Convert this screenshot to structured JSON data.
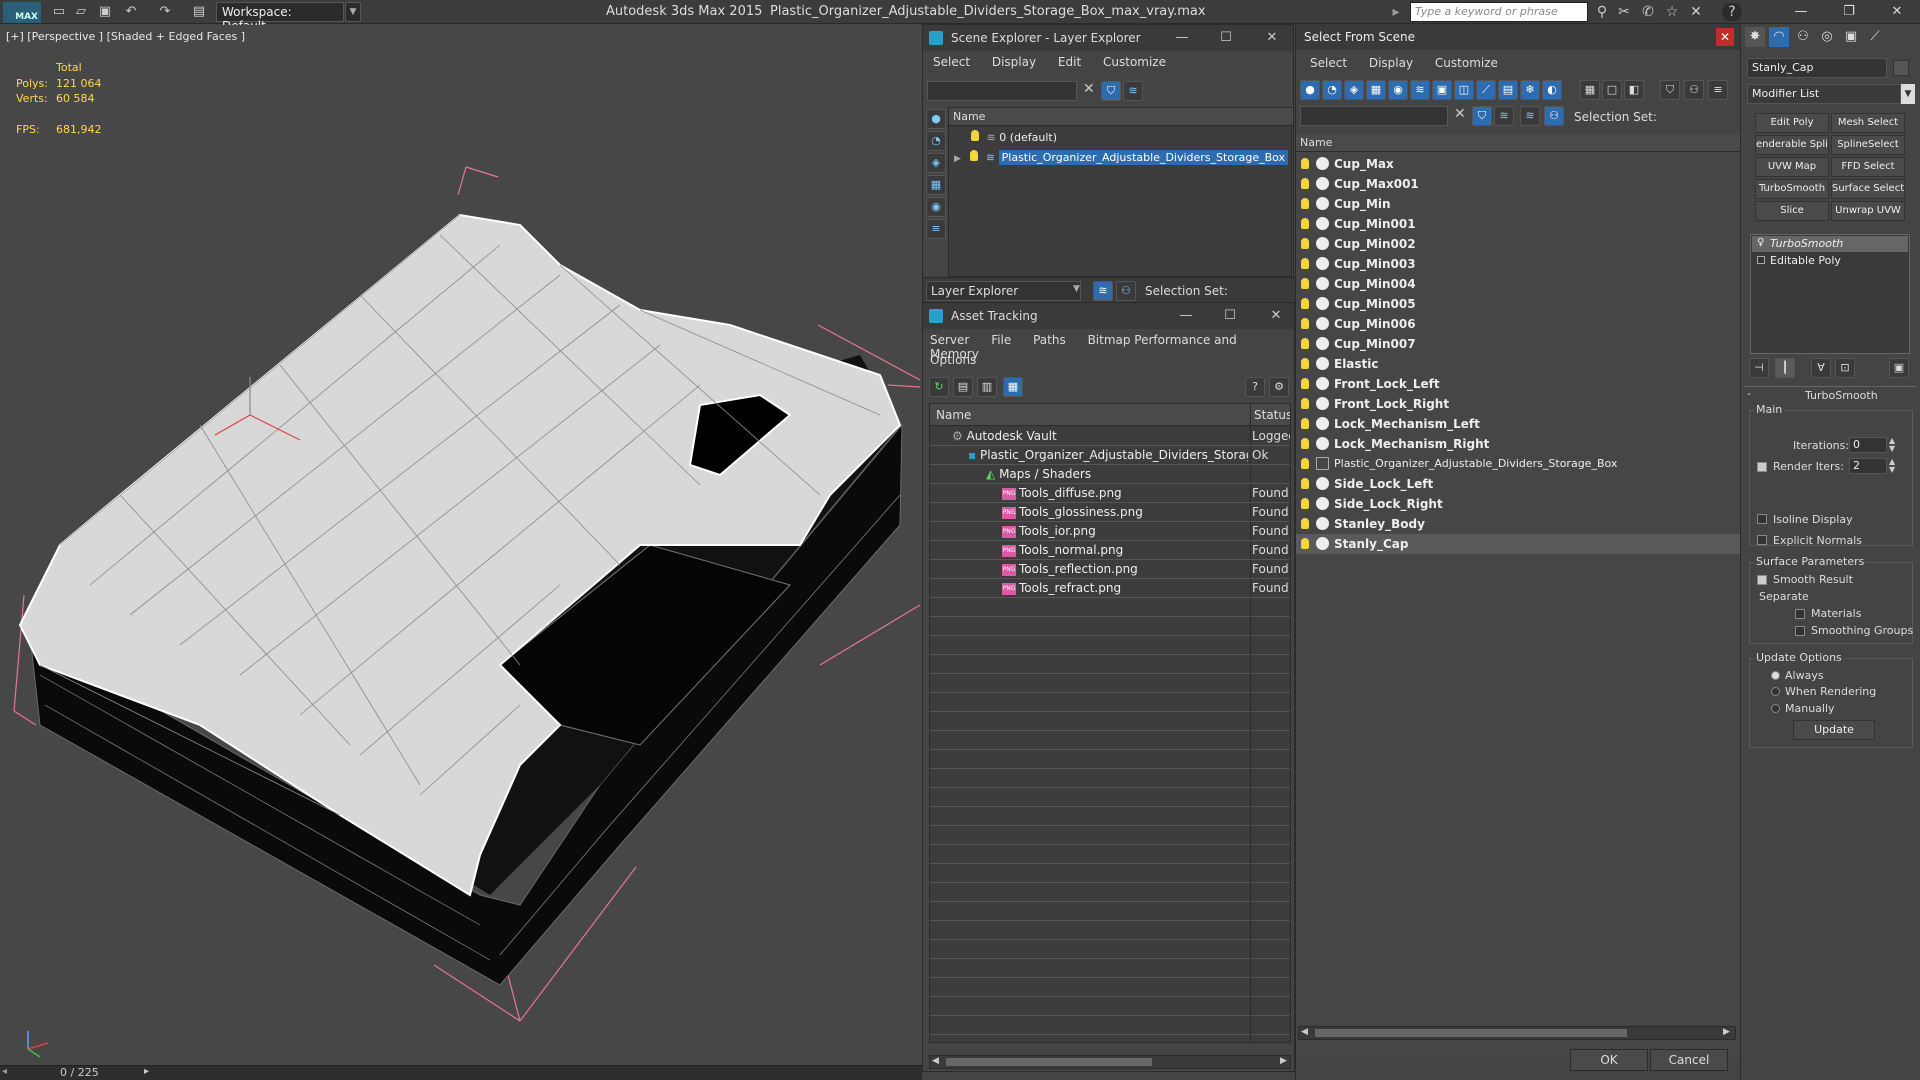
{
  "titlebar": {
    "logo": "MAX",
    "workspace": "Workspace: Default",
    "app_title": "Autodesk 3ds Max  2015",
    "doc_title": "Plastic_Organizer_Adjustable_Dividers_Storage_Box_max_vray.max",
    "search_placeholder": "Type a keyword or phrase"
  },
  "viewport": {
    "label": "[+] [Perspective ] [Shaded + Edged Faces ]",
    "stats_total": "Total",
    "polys_label": "Polys:",
    "polys": "121 064",
    "verts_label": "Verts:",
    "verts": "60 584",
    "fps_label": "FPS:",
    "fps": "681,942",
    "timeline": "0 / 225"
  },
  "scene_explorer": {
    "title": "Scene Explorer - Layer Explorer",
    "menu": [
      "Select",
      "Display",
      "Edit",
      "Customize"
    ],
    "column": "Name",
    "rows": [
      "0 (default)",
      "Plastic_Organizer_Adjustable_Dividers_Storage_Box"
    ],
    "explorer": "Layer Explorer",
    "selection_set": "Selection Set:"
  },
  "asset_tracking": {
    "title": "Asset Tracking",
    "menu": [
      "Server",
      "File",
      "Paths",
      "Bitmap Performance and Memory"
    ],
    "menu2": "Options",
    "columns": [
      "Name",
      "Status"
    ],
    "rows": [
      {
        "name": "Autodesk Vault",
        "status": "Logged"
      },
      {
        "name": "Plastic_Organizer_Adjustable_Dividers_Storage_Box_max_vray.max",
        "status": "Ok"
      },
      {
        "name": "Maps / Shaders",
        "status": ""
      },
      {
        "name": "Tools_diffuse.png",
        "status": "Found"
      },
      {
        "name": "Tools_glossiness.png",
        "status": "Found"
      },
      {
        "name": "Tools_ior.png",
        "status": "Found"
      },
      {
        "name": "Tools_normal.png",
        "status": "Found"
      },
      {
        "name": "Tools_reflection.png",
        "status": "Found"
      },
      {
        "name": "Tools_refract.png",
        "status": "Found"
      }
    ]
  },
  "select_from_scene": {
    "title": "Select From Scene",
    "menu": [
      "Select",
      "Display",
      "Customize"
    ],
    "selection_set": "Selection Set:",
    "column": "Name",
    "items": [
      "Cup_Max",
      "Cup_Max001",
      "Cup_Min",
      "Cup_Min001",
      "Cup_Min002",
      "Cup_Min003",
      "Cup_Min004",
      "Cup_Min005",
      "Cup_Min006",
      "Cup_Min007",
      "Elastic",
      "Front_Lock_Left",
      "Front_Lock_Right",
      "Lock_Mechanism_Left",
      "Lock_Mechanism_Right",
      "Plastic_Organizer_Adjustable_Dividers_Storage_Box",
      "Side_Lock_Left",
      "Side_Lock_Right",
      "Stanley_Body",
      "Stanly_Cap"
    ],
    "ok": "OK",
    "cancel": "Cancel"
  },
  "command_panel": {
    "object_name": "Stanly_Cap",
    "modifier_list": "Modifier List",
    "buttons": [
      "Edit Poly",
      "Mesh Select",
      "enderable Spli",
      "SplineSelect",
      "UVW Map",
      "FFD Select",
      "TurboSmooth",
      "Surface Select",
      "Slice",
      "Unwrap UVW"
    ],
    "stack": [
      "TurboSmooth",
      "Editable Poly"
    ],
    "rollout": "TurboSmooth",
    "main": "Main",
    "iterations_label": "Iterations:",
    "iterations": "0",
    "render_iters_label": "Render Iters:",
    "render_iters": "2",
    "isoline": "Isoline Display",
    "explicit": "Explicit Normals",
    "surface_params": "Surface Parameters",
    "smooth_result": "Smooth Result",
    "separate": "Separate",
    "materials": "Materials",
    "smoothing_groups": "Smoothing Groups",
    "update_options": "Update Options",
    "always": "Always",
    "when_rendering": "When Rendering",
    "manually": "Manually",
    "update": "Update"
  }
}
